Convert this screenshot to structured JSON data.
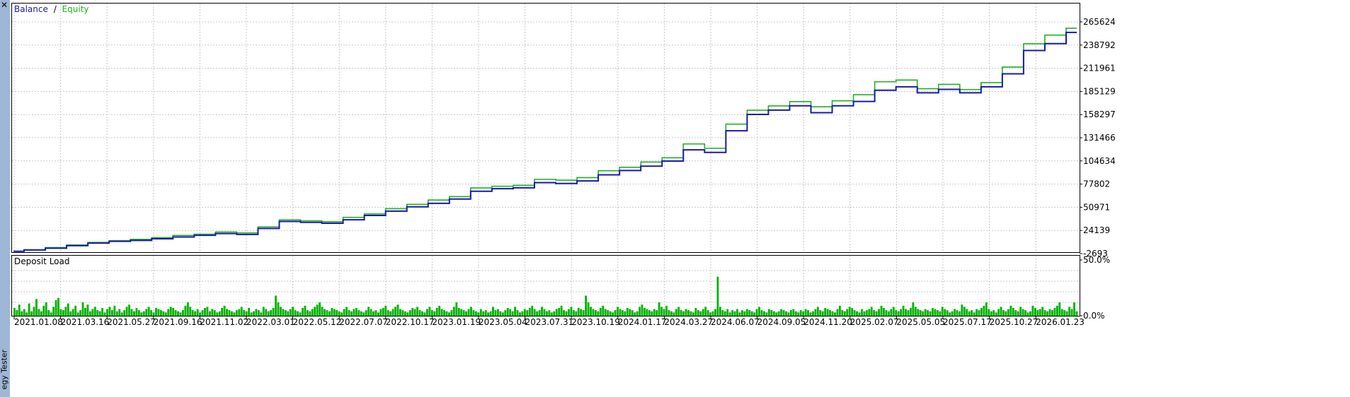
{
  "window": {
    "close_icon": "close-icon",
    "side_label": "egy Tester"
  },
  "colors": {
    "balance": "#1a1aa8",
    "equity": "#22b022",
    "deposit_bars": "#00b400",
    "grid": "#c8c8c8",
    "sidebar": "#9fb6d6"
  },
  "chart_data": [
    {
      "type": "line",
      "legend": {
        "balance_label": "Balance",
        "separator": "/",
        "equity_label": "Equity",
        "placement": "top-left"
      },
      "grid": true,
      "y_ticks": [
        "265624",
        "238792",
        "211961",
        "185129",
        "158297",
        "131466",
        "104634",
        "77802",
        "50971",
        "24139",
        "-2693"
      ],
      "ylim": [
        -2693,
        280000
      ],
      "x_tick_labels": [
        "2021.01.08",
        "2021.03.16",
        "2021.05.27",
        "2021.09.16",
        "2021.11.02",
        "2022.03.01",
        "2022.05.12",
        "2022.07.07",
        "2022.10.17",
        "2023.01.19",
        "2023.05.04",
        "2023.07.31",
        "2023.10.19",
        "2024.01.17",
        "2024.03.27",
        "2024.06.07",
        "2024.09.05",
        "2024.11.20",
        "2025.02.07",
        "2025.05.05",
        "2025.07.17",
        "2025.10.27",
        "2026.01.23"
      ],
      "x_range": [
        0,
        100
      ],
      "series": [
        {
          "name": "Balance",
          "x": [
            0,
            2,
            4,
            6,
            8,
            10,
            12,
            14,
            16,
            18,
            20,
            22,
            24,
            26,
            28,
            30,
            32,
            34,
            36,
            38,
            40,
            42,
            44,
            46,
            48,
            50,
            52,
            54,
            56,
            58,
            60,
            62,
            64,
            66,
            68,
            70,
            72,
            74,
            76,
            78,
            80,
            82,
            84,
            86,
            88,
            90,
            92,
            94,
            96,
            98,
            100
          ],
          "values": [
            0,
            1500,
            3500,
            6500,
            9500,
            11500,
            12500,
            14500,
            16500,
            18500,
            20500,
            19500,
            26500,
            34500,
            33500,
            32500,
            36500,
            41500,
            46500,
            51500,
            55500,
            60500,
            69500,
            72500,
            73500,
            79500,
            78500,
            81500,
            88500,
            93500,
            98500,
            104500,
            117500,
            114500,
            139500,
            158500,
            163500,
            168500,
            160500,
            168500,
            173500,
            186500,
            190500,
            183500,
            187500,
            183500,
            190500,
            205500,
            232500,
            240500,
            253500
          ]
        },
        {
          "name": "Equity",
          "x": [
            0,
            2,
            4,
            6,
            8,
            10,
            12,
            14,
            16,
            18,
            20,
            22,
            24,
            26,
            28,
            30,
            32,
            34,
            36,
            38,
            40,
            42,
            44,
            46,
            48,
            50,
            52,
            54,
            56,
            58,
            60,
            62,
            64,
            66,
            68,
            70,
            72,
            74,
            76,
            78,
            80,
            82,
            84,
            86,
            88,
            90,
            92,
            94,
            96,
            98,
            100
          ],
          "values": [
            0,
            1800,
            4300,
            7300,
            10300,
            12300,
            13800,
            15800,
            18300,
            19800,
            22300,
            21300,
            28300,
            36300,
            35300,
            34300,
            39300,
            43300,
            49300,
            54300,
            59300,
            63300,
            73300,
            75300,
            76300,
            83300,
            82300,
            85300,
            93300,
            97300,
            103300,
            108300,
            124300,
            119300,
            147300,
            163300,
            168300,
            173300,
            167300,
            174300,
            181300,
            196300,
            198300,
            188300,
            193300,
            187300,
            195300,
            213300,
            240300,
            250300,
            258300
          ]
        }
      ]
    },
    {
      "type": "bar",
      "title": "Deposit Load",
      "y_ticks": [
        "50.0%",
        "0.0%"
      ],
      "ylim": [
        0,
        50
      ],
      "unit": "%",
      "series": [
        {
          "name": "Deposit Load",
          "values": [
            7,
            5,
            10,
            4,
            6,
            3,
            11,
            4,
            8,
            15,
            6,
            4,
            9,
            12,
            5,
            3,
            8,
            14,
            16,
            6,
            5,
            8,
            11,
            4,
            6,
            9,
            3,
            5,
            12,
            7,
            10,
            4,
            6,
            8,
            5,
            4,
            7,
            3,
            6,
            8,
            5,
            9,
            4,
            6,
            3,
            5,
            8,
            10,
            6,
            4,
            7,
            5,
            3,
            4,
            6,
            8,
            5,
            3,
            7,
            6,
            5,
            4,
            3,
            6,
            8,
            7,
            5,
            4,
            3,
            5,
            9,
            12,
            8,
            5,
            4,
            6,
            3,
            5,
            7,
            8,
            4,
            6,
            5,
            3,
            4,
            7,
            9,
            6,
            5,
            4,
            3,
            5,
            6,
            8,
            5,
            4,
            7,
            3,
            4,
            6,
            5,
            3,
            8,
            6,
            4,
            5,
            7,
            18,
            12,
            8,
            6,
            5,
            4,
            6,
            8,
            5,
            4,
            3,
            7,
            9,
            5,
            4,
            6,
            8,
            10,
            12,
            8,
            6,
            5,
            4,
            7,
            6,
            5,
            4,
            3,
            6,
            8,
            5,
            4,
            6,
            7,
            5,
            4,
            3,
            5,
            8,
            6,
            4,
            5,
            3,
            6,
            7,
            9,
            5,
            4,
            6,
            8,
            10,
            6,
            5,
            4,
            3,
            5,
            7,
            6,
            8,
            5,
            4,
            3,
            6,
            8,
            5,
            4,
            7,
            9,
            6,
            5,
            4,
            3,
            5,
            8,
            12,
            7,
            6,
            5,
            4,
            6,
            8,
            5,
            4,
            3,
            6,
            4,
            5,
            3,
            4,
            8,
            5,
            6,
            4,
            3,
            5,
            7,
            6,
            4,
            8,
            5,
            3,
            4,
            6,
            5,
            7,
            9,
            6,
            4,
            5,
            8,
            6,
            4,
            5,
            3,
            4,
            6,
            7,
            9,
            5,
            4,
            6,
            8,
            5,
            4,
            7,
            6,
            5,
            18,
            12,
            8,
            6,
            5,
            4,
            7,
            9,
            6,
            5,
            4,
            3,
            5,
            8,
            6,
            5,
            4,
            7,
            6,
            5,
            3,
            4,
            8,
            10,
            7,
            6,
            5,
            4,
            6,
            5,
            12,
            8,
            6,
            9,
            5,
            4,
            3,
            6,
            8,
            5,
            4,
            6,
            5,
            4,
            3,
            7,
            5,
            4,
            6,
            8,
            5,
            3,
            4,
            6,
            35,
            8,
            5,
            4,
            6,
            3,
            5,
            4,
            6,
            3,
            5,
            4,
            6,
            5,
            4,
            3,
            6,
            8,
            5,
            4,
            3,
            6,
            5,
            4,
            3,
            4,
            6,
            5,
            4,
            3,
            5,
            6,
            4,
            3,
            5,
            4,
            6,
            5,
            3,
            4,
            6,
            8,
            5,
            4,
            7,
            6,
            5,
            4,
            3,
            6,
            9,
            5,
            4,
            6,
            8,
            7,
            5,
            4,
            3,
            6,
            4,
            5,
            6,
            8,
            5,
            4,
            6,
            9,
            7,
            5,
            4,
            6,
            8,
            5,
            4,
            6,
            9,
            6,
            5,
            7,
            12,
            8,
            6,
            5,
            4,
            6,
            5,
            4,
            7,
            6,
            5,
            4,
            8,
            6,
            5,
            3,
            4,
            6,
            5,
            4,
            10,
            8,
            6,
            4,
            5,
            3,
            6,
            5,
            7,
            9,
            12,
            6,
            4,
            5,
            3,
            6,
            8,
            5,
            4,
            6,
            9,
            7,
            5,
            4,
            8,
            6,
            5,
            3,
            4,
            9,
            7,
            5,
            6,
            8,
            5,
            4,
            6,
            5,
            7,
            9,
            12,
            6,
            5,
            4,
            8,
            6,
            12,
            4
          ]
        }
      ]
    }
  ]
}
